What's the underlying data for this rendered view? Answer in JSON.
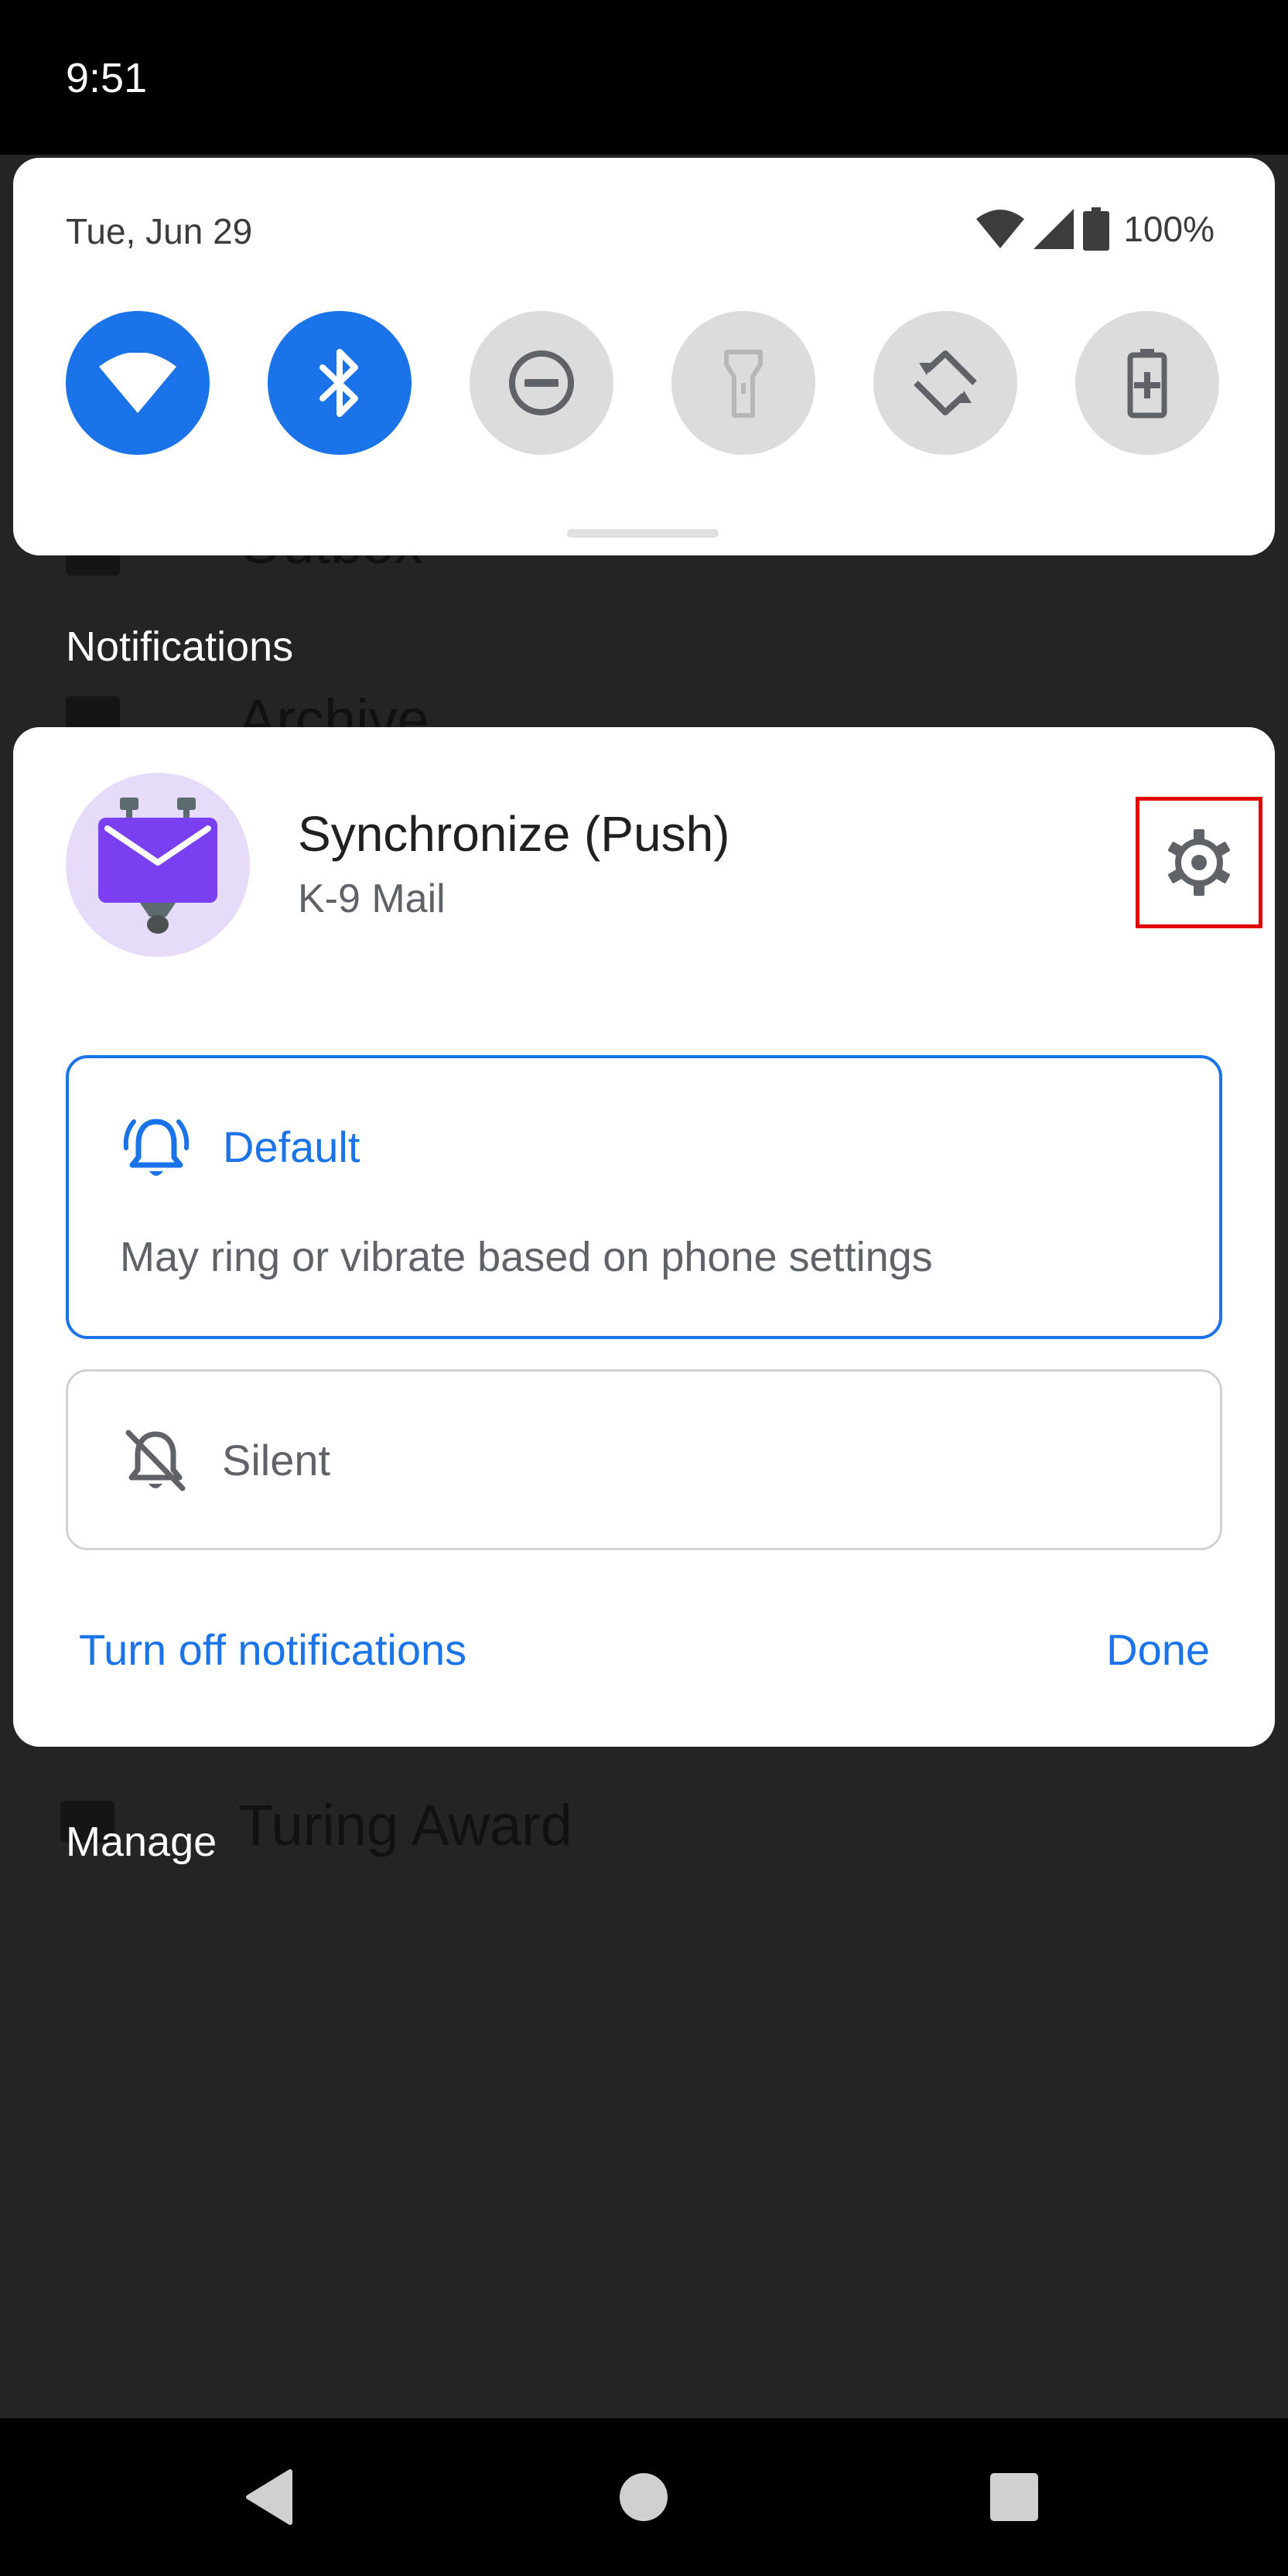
{
  "status_bar": {
    "time": "9:51"
  },
  "quick_settings": {
    "date": "Tue, Jun 29",
    "battery_percent": "100%",
    "tiles": [
      {
        "name": "wifi",
        "active": true
      },
      {
        "name": "bluetooth",
        "active": true
      },
      {
        "name": "do-not-disturb",
        "active": false
      },
      {
        "name": "flashlight",
        "active": false
      },
      {
        "name": "auto-rotate",
        "active": false
      },
      {
        "name": "battery-saver",
        "active": false
      }
    ]
  },
  "background_app": {
    "items": [
      "Outbox",
      "Archive",
      "Turing Award"
    ]
  },
  "notifications": {
    "header": "Notifications",
    "manage_label": "Manage",
    "card": {
      "title": "Synchronize (Push)",
      "app_name": "K-9 Mail",
      "options": {
        "default": {
          "label": "Default",
          "description": "May ring or vibrate based on phone settings",
          "selected": true
        },
        "silent": {
          "label": "Silent",
          "selected": false
        }
      },
      "turn_off_label": "Turn off notifications",
      "done_label": "Done"
    }
  },
  "colors": {
    "accent": "#1a73e8",
    "scrim": "#242424",
    "app_icon_bg": "#e6dcfa",
    "app_icon_envelope": "#7b3ff2",
    "highlight": "#e00000"
  }
}
